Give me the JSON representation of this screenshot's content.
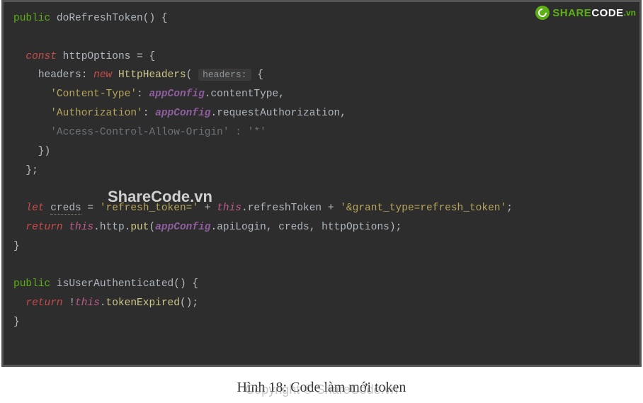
{
  "caption": "Hình 18: Code làm mới token",
  "watermark_center": "ShareCode.vn",
  "copyright_watermark": "Copyright © ShareCode.vn",
  "logo": {
    "share": "SHARE",
    "code": "CODE",
    "vn": ".vn"
  },
  "code": {
    "line1": {
      "kw": "public",
      "name": "doRefreshToken",
      "parens": "()",
      "brace": " {"
    },
    "line2": "",
    "line3": {
      "kw": "const",
      "name": "httpOptions",
      "rest": " = {"
    },
    "line4": {
      "prop": "headers",
      "colon": ": ",
      "kw": "new",
      "cls": "HttpHeaders",
      "hint": "headers:",
      "brace": " {"
    },
    "line5": {
      "key": "'Content-Type'",
      "colon": ": ",
      "obj": "appConfig",
      "dot": ".",
      "prop": "contentType",
      "end": ","
    },
    "line6": {
      "key": "'Authorization'",
      "colon": ": ",
      "obj": "appConfig",
      "dot": ".",
      "prop": "requestAuthorization",
      "end": ","
    },
    "line7": {
      "key": "'Access-Control-Allow-Origin'",
      "colon": " : ",
      "val": "'*'"
    },
    "line8": "    })",
    "line9": "  };",
    "line10": "",
    "line11": {
      "kw": "let",
      "name": "creds",
      "eq": " = ",
      "s1": "'refresh_token='",
      "p1": " + ",
      "this": "this",
      "d": ".",
      "prop": "refreshToken",
      "p2": " + ",
      "s2": "'&grant_type=refresh_token'",
      "end": ";"
    },
    "line12": {
      "kw": "return",
      "this": "this",
      "d1": ".",
      "http": "http",
      "d2": ".",
      "put": "put",
      "open": "(",
      "obj": "appConfig",
      "d3": ".",
      "api": "apiLogin",
      "args": ", creds, httpOptions)",
      "end": ";"
    },
    "line13": "}",
    "line14": "",
    "line15": {
      "kw": "public",
      "name": "isUserAuthenticated",
      "parens": "()",
      "brace": " {"
    },
    "line16": {
      "kw": "return",
      "bang": " !",
      "this": "this",
      "d": ".",
      "method": "tokenExpired",
      "parens": "()",
      "end": ";"
    },
    "line17": "}"
  }
}
